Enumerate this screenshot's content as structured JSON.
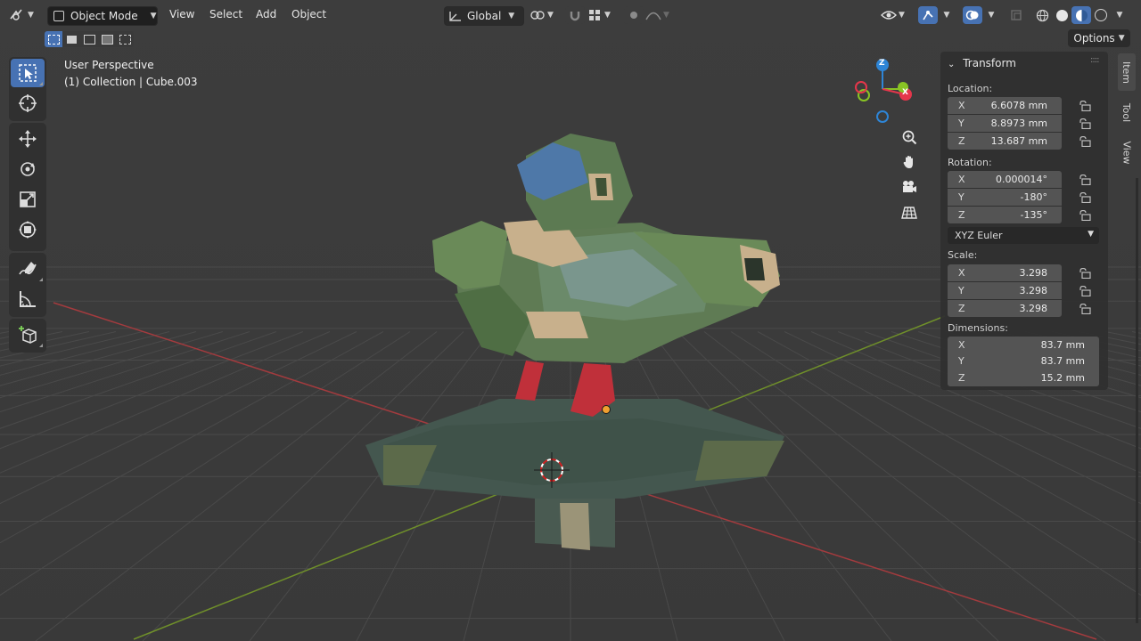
{
  "header": {
    "mode": "Object Mode",
    "menus": [
      "View",
      "Select",
      "Add",
      "Object"
    ],
    "orientation": "Global",
    "options_label": "Options"
  },
  "viewport": {
    "view_name": "User Perspective",
    "collection_info": "(1) Collection | Cube.003",
    "gizmo": {
      "x": "X",
      "y": "Y",
      "z": "Z"
    }
  },
  "panel": {
    "title": "Transform",
    "location_label": "Location:",
    "location": [
      {
        "axis": "X",
        "value": "6.6078 mm"
      },
      {
        "axis": "Y",
        "value": "8.8973 mm"
      },
      {
        "axis": "Z",
        "value": "13.687 mm"
      }
    ],
    "rotation_label": "Rotation:",
    "rotation": [
      {
        "axis": "X",
        "value": "0.000014°"
      },
      {
        "axis": "Y",
        "value": "-180°"
      },
      {
        "axis": "Z",
        "value": "-135°"
      }
    ],
    "rotation_mode": "XYZ Euler",
    "scale_label": "Scale:",
    "scale": [
      {
        "axis": "X",
        "value": "3.298"
      },
      {
        "axis": "Y",
        "value": "3.298"
      },
      {
        "axis": "Z",
        "value": "3.298"
      }
    ],
    "dimensions_label": "Dimensions:",
    "dimensions": [
      {
        "axis": "X",
        "value": "83.7 mm"
      },
      {
        "axis": "Y",
        "value": "83.7 mm"
      },
      {
        "axis": "Z",
        "value": "15.2 mm"
      }
    ]
  },
  "sidebar_tabs": [
    "Item",
    "Tool",
    "View"
  ],
  "colors": {
    "accent": "#4772b3",
    "axis_x": "#e5364b",
    "axis_y": "#89c424",
    "axis_z": "#2e85d6"
  }
}
